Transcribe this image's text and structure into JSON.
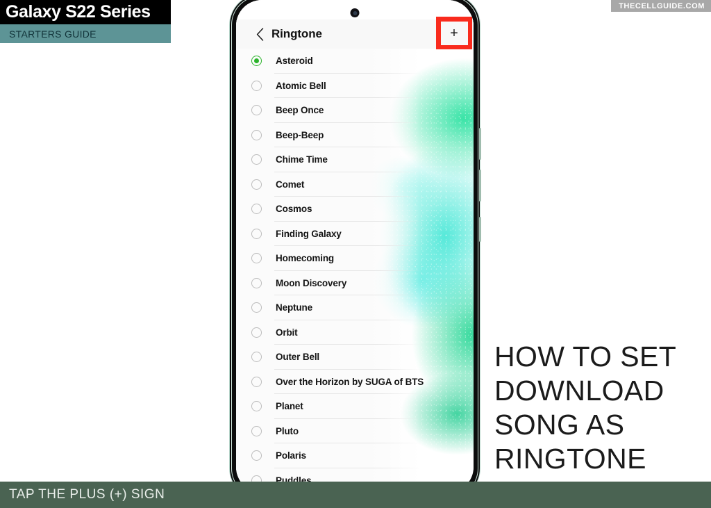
{
  "branding": {
    "title": "Galaxy S22 Series",
    "subtitle": "STARTERS GUIDE",
    "watermark": "THECELLGUIDE.COM",
    "black_bar_color": "#000000",
    "teal_bar_color": "#5d9496",
    "watermark_bg": "#a8a8a8"
  },
  "headline": {
    "lines": [
      "HOW TO SET",
      "DOWNLOAD",
      "SONG AS",
      "RINGTONE"
    ]
  },
  "caption": {
    "text": "TAP THE PLUS (+) SIGN",
    "bar_color": "#4a6352"
  },
  "phone": {
    "camera_label": "front-camera-punch-hole",
    "header": {
      "back_label": "‹",
      "title": "Ringtone",
      "add_label": "+",
      "highlight_color": "#f92b1d"
    },
    "selected_radio_color": "#2bb32b",
    "ringtones": [
      {
        "label": "Asteroid",
        "selected": true
      },
      {
        "label": "Atomic Bell",
        "selected": false
      },
      {
        "label": "Beep Once",
        "selected": false
      },
      {
        "label": "Beep-Beep",
        "selected": false
      },
      {
        "label": "Chime Time",
        "selected": false
      },
      {
        "label": "Comet",
        "selected": false
      },
      {
        "label": "Cosmos",
        "selected": false
      },
      {
        "label": "Finding Galaxy",
        "selected": false
      },
      {
        "label": "Homecoming",
        "selected": false
      },
      {
        "label": "Moon Discovery",
        "selected": false
      },
      {
        "label": "Neptune",
        "selected": false
      },
      {
        "label": "Orbit",
        "selected": false
      },
      {
        "label": "Outer Bell",
        "selected": false
      },
      {
        "label": "Over the Horizon by SUGA of BTS",
        "selected": false
      },
      {
        "label": "Planet",
        "selected": false
      },
      {
        "label": "Pluto",
        "selected": false
      },
      {
        "label": "Polaris",
        "selected": false
      },
      {
        "label": "Puddles",
        "selected": false
      }
    ]
  }
}
